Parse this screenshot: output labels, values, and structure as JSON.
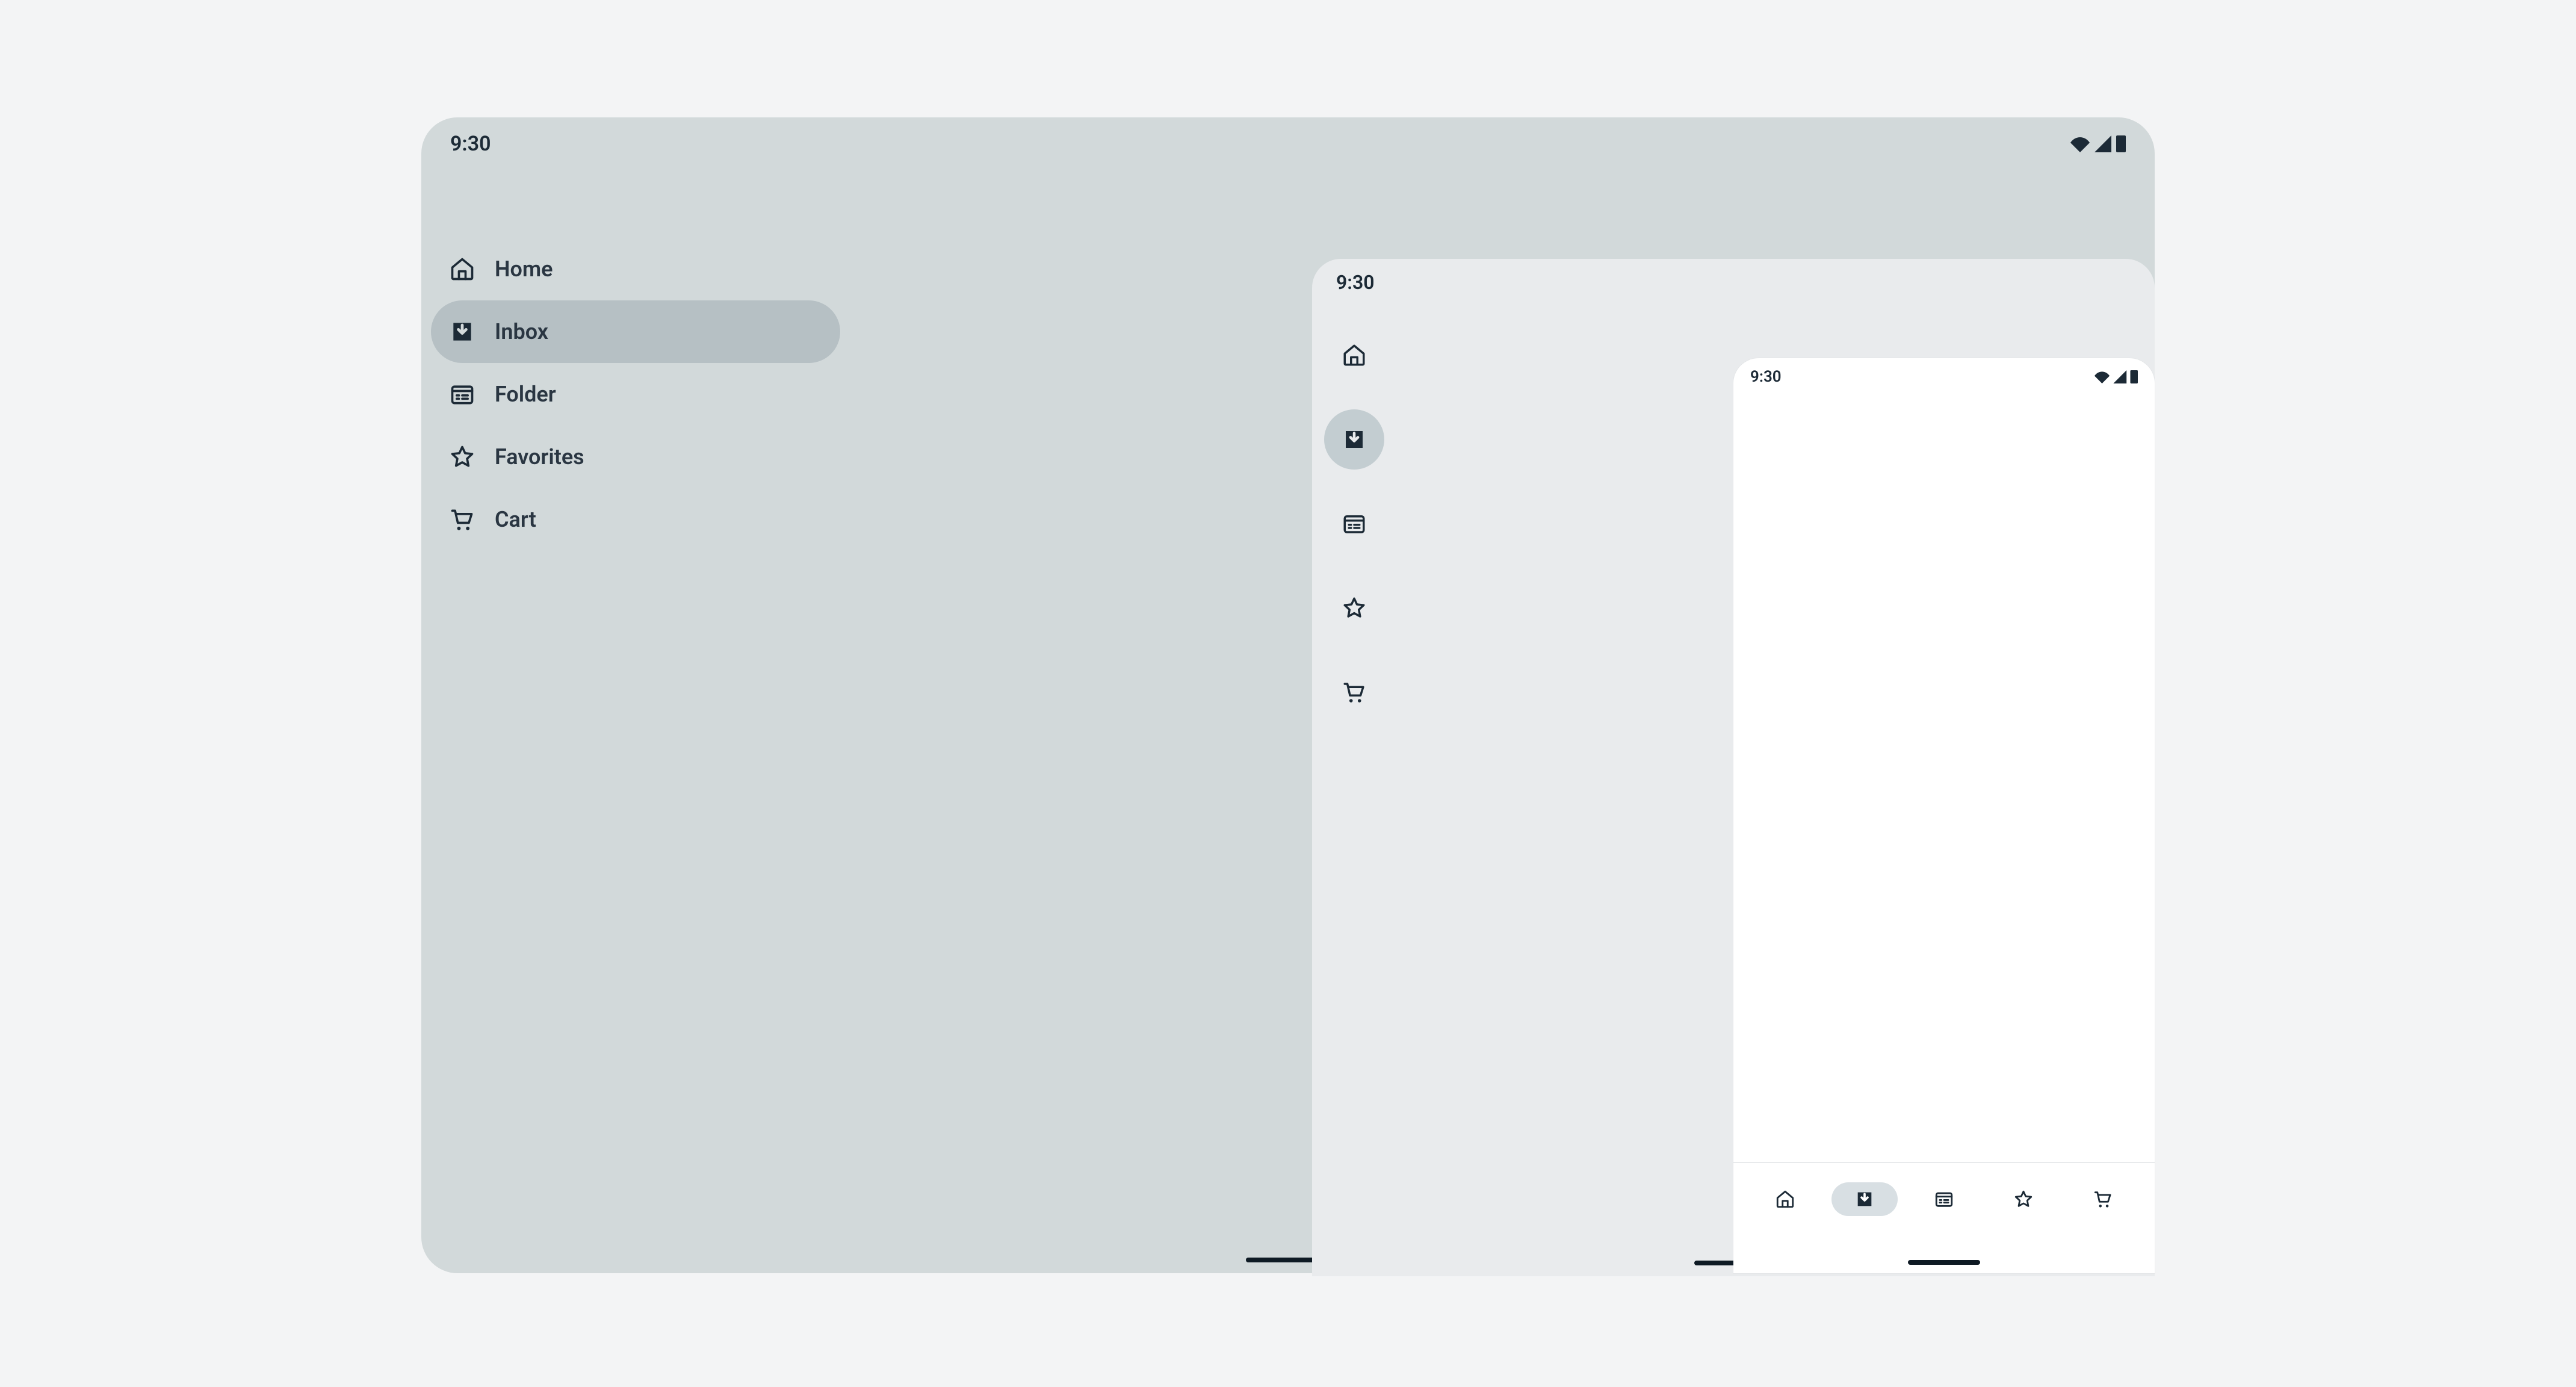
{
  "status": {
    "time": "9:30"
  },
  "nav": {
    "items": [
      {
        "id": "home",
        "label": "Home",
        "active": false
      },
      {
        "id": "inbox",
        "label": "Inbox",
        "active": true
      },
      {
        "id": "folder",
        "label": "Folder",
        "active": false
      },
      {
        "id": "favorites",
        "label": "Favorites",
        "active": false
      },
      {
        "id": "cart",
        "label": "Cart",
        "active": false
      }
    ]
  }
}
